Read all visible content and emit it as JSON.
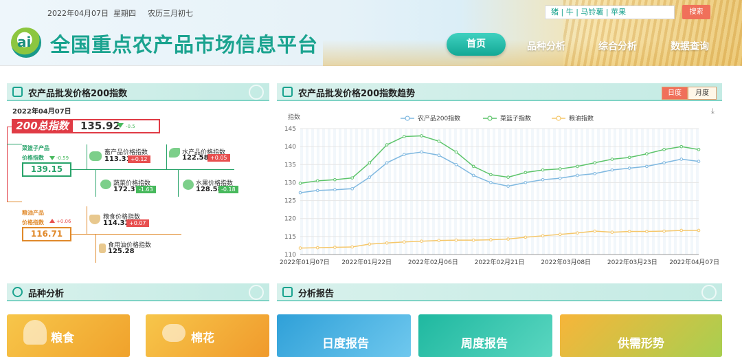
{
  "header": {
    "date": "2022年04月07日",
    "weekday": "星期四",
    "lunar": "农历三月初七",
    "site_title": "全国重点农产品市场信息平台",
    "logo_text": "ai",
    "search_placeholder": "猪 | 牛 | 马铃薯 | 苹果",
    "search_button": "搜索",
    "nav": [
      "首页",
      "品种分析",
      "综合分析",
      "数据查询"
    ]
  },
  "index_panel": {
    "title": "农产品批发价格200指数",
    "date": "2022年04月07日",
    "total_label": "200总指数",
    "total_value": "135.92",
    "total_change": "-0.5",
    "basket": {
      "label1": "菜篮子产品",
      "label2": "价格指数",
      "change": "-0.59",
      "value": "139.15"
    },
    "grain": {
      "label1": "粮油产品",
      "label2": "价格指数",
      "change": "+0.06",
      "value": "116.71"
    },
    "items": [
      {
        "name": "畜产品价格指数",
        "value": "113.31",
        "change": "+0.12"
      },
      {
        "name": "水产品价格指数",
        "value": "122.58",
        "change": "+0.05"
      },
      {
        "name": "蔬菜价格指数",
        "value": "172.37",
        "change": "-1.63"
      },
      {
        "name": "水果价格指数",
        "value": "128.58",
        "change": "-0.18"
      },
      {
        "name": "粮食价格指数",
        "value": "114.32",
        "change": "+0.07"
      },
      {
        "name": "食用油价格指数",
        "value": "125.28",
        "change": ""
      }
    ]
  },
  "trend_panel": {
    "title": "农产品批发价格200指数趋势",
    "tabs": [
      "日度",
      "月度"
    ],
    "download_icon": "download-icon"
  },
  "variety_panel": {
    "title": "品种分析",
    "cards": [
      "粮食",
      "棉花"
    ]
  },
  "report_panel": {
    "title": "分析报告",
    "cards": [
      "日度报告",
      "周度报告",
      "供需形势"
    ]
  },
  "chart_data": {
    "type": "line",
    "ylabel": "指数",
    "ylim": [
      110,
      145
    ],
    "yticks": [
      110,
      115,
      120,
      125,
      130,
      135,
      140,
      145
    ],
    "xticks": [
      "2022年01月07日",
      "2022年01月22日",
      "2022年02月06日",
      "2022年02月21日",
      "2022年03月08日",
      "2022年03月23日",
      "2022年04月07日"
    ],
    "x": [
      "01-07",
      "01-11",
      "01-15",
      "01-19",
      "01-23",
      "01-27",
      "01-31",
      "02-04",
      "02-08",
      "02-12",
      "02-16",
      "02-20",
      "02-24",
      "02-28",
      "03-04",
      "03-08",
      "03-12",
      "03-16",
      "03-20",
      "03-24",
      "03-28",
      "04-01",
      "04-05",
      "04-07"
    ],
    "series": [
      {
        "name": "农产品200指数",
        "color": "#7fb8e0",
        "values": [
          127.2,
          127.8,
          128.0,
          128.3,
          131.5,
          135.5,
          137.8,
          138.5,
          137.6,
          135.0,
          132.0,
          130.0,
          129.0,
          130.0,
          130.8,
          131.2,
          132.0,
          132.5,
          133.5,
          134.0,
          134.5,
          135.5,
          136.5,
          135.9
        ]
      },
      {
        "name": "菜篮子指数",
        "color": "#5cc46a",
        "values": [
          129.8,
          130.5,
          130.8,
          131.3,
          135.5,
          140.5,
          142.8,
          143.0,
          141.5,
          138.5,
          134.5,
          132.2,
          131.5,
          132.8,
          133.5,
          133.8,
          134.5,
          135.5,
          136.5,
          137.0,
          138.0,
          139.2,
          140.0,
          139.2
        ]
      },
      {
        "name": "粮油指数",
        "color": "#f5c76a",
        "values": [
          111.8,
          111.9,
          112.0,
          112.1,
          112.9,
          113.2,
          113.5,
          113.7,
          113.9,
          114.0,
          114.0,
          114.1,
          114.3,
          114.8,
          115.2,
          115.6,
          116.0,
          116.5,
          116.2,
          116.4,
          116.4,
          116.5,
          116.7,
          116.7
        ]
      }
    ]
  }
}
